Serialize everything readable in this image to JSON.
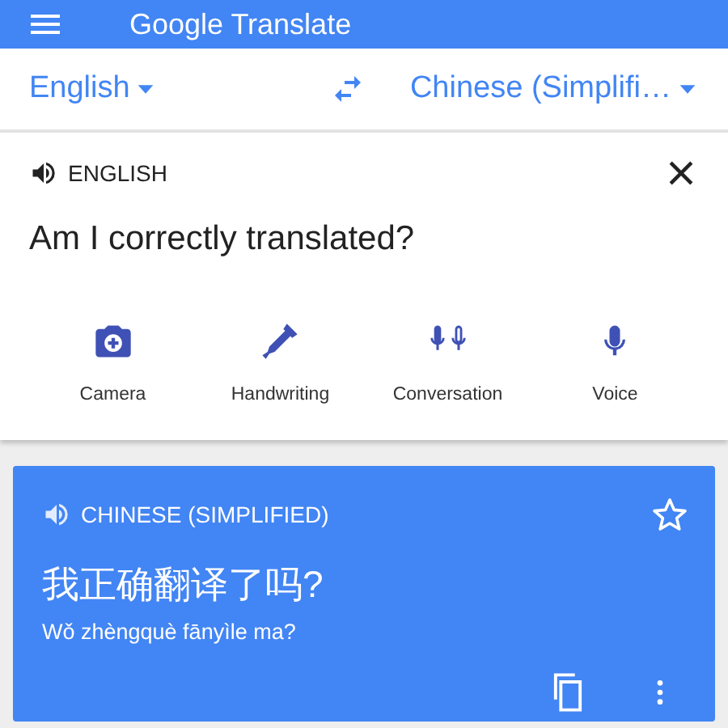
{
  "app_bar": {
    "title": "Google Translate"
  },
  "languages": {
    "source": "English",
    "target": "Chinese (Simplifi…"
  },
  "input": {
    "language_label": "ENGLISH",
    "text": "Am I correctly translated?"
  },
  "tools": [
    {
      "kind": "camera",
      "label": "Camera"
    },
    {
      "kind": "handwriting",
      "label": "Handwriting"
    },
    {
      "kind": "conversation",
      "label": "Conversation"
    },
    {
      "kind": "voice",
      "label": "Voice"
    }
  ],
  "result": {
    "language_label": "CHINESE (SIMPLIFIED)",
    "text": "我正确翻译了吗?",
    "romanization": "Wǒ zhèngquè fānyìle ma?",
    "starred": false
  }
}
